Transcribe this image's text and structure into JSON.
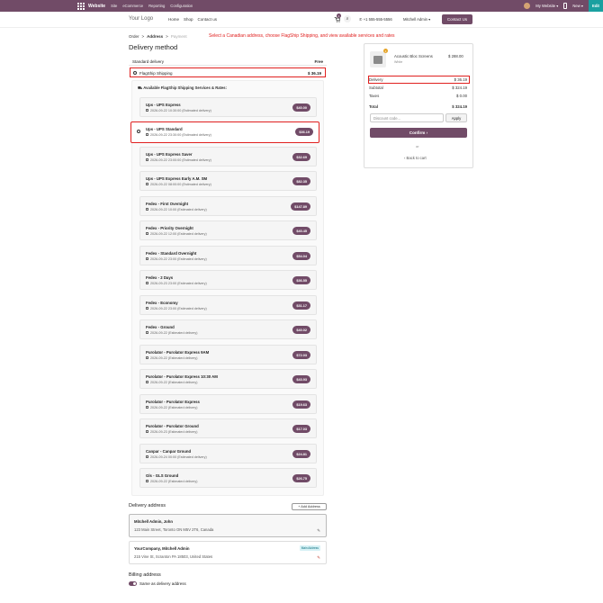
{
  "topbar": {
    "brand": "Website",
    "menu": [
      "Site",
      "eCommerce",
      "Reporting",
      "Configuration"
    ],
    "my_website": "My Website ▾",
    "new": "New ▾",
    "edit": "Edit"
  },
  "header": {
    "logo": "Your Logo",
    "nav": [
      "Home",
      "Shop",
      "Contact us"
    ],
    "cart_count": "1",
    "phone": "+1 555-555-5556",
    "user": "Mitchell Admin ▾",
    "contact_button": "Contact Us"
  },
  "breadcrumb": {
    "order": "Order",
    "address": "Address",
    "payment": "Payment",
    "sep": ">"
  },
  "hint": "Select a Canadian address, choose FlagShip Shipping, and view available services and rates",
  "delivery": {
    "title": "Delivery method",
    "standard": {
      "label": "Standard delivery",
      "value": "Free"
    },
    "flagship": {
      "label": "FlagShip Shipping",
      "value": "$ 36.19"
    },
    "rates_heading": "Available FlagShip Shipping Services & Rates:",
    "services": [
      {
        "name": "Ups - UPS Express",
        "date": "2026-09-22 10:30:00 (Estimated delivery)",
        "price": "$40.00"
      },
      {
        "name": "Ups - UPS Standard",
        "date": "2026-09-22 23:30:00 (Estimated delivery)",
        "price": "$36.19"
      },
      {
        "name": "Ups - UPS Express Saver",
        "date": "2026-09-22 23:00:00 (Estimated delivery)",
        "price": "$32.69"
      },
      {
        "name": "Ups - UPS Express Early A.M. SM",
        "date": "2026-09-22 08:00:00 (Estimated delivery)",
        "price": "$82.35"
      },
      {
        "name": "Fedex - First Overnight",
        "date": "2026-09-22 10:00 (Estimated delivery)",
        "price": "$147.89"
      },
      {
        "name": "Fedex - Priority Overnight",
        "date": "2026-09-22 12:00 (Estimated delivery)",
        "price": "$40.45"
      },
      {
        "name": "Fedex - Standard Overnight",
        "date": "2026-09-22 23:00 (Estimated delivery)",
        "price": "$54.04"
      },
      {
        "name": "Fedex - 2 Days",
        "date": "2026-09-23 23:00 (Estimated delivery)",
        "price": "$36.55"
      },
      {
        "name": "Fedex - Economy",
        "date": "2026-09-22 23:00 (Estimated delivery)",
        "price": "$31.17"
      },
      {
        "name": "Fedex - Ground",
        "date": "2026-09-22 (Estimated delivery)",
        "price": "$40.02"
      },
      {
        "name": "Purolator - Purolator Express 9AM",
        "date": "2026-09-22 (Estimated delivery)",
        "price": "$72.03"
      },
      {
        "name": "Purolator - Purolator Express 10:30 AM",
        "date": "2026-09-22 (Estimated delivery)",
        "price": "$43.93"
      },
      {
        "name": "Purolator - Purolator Express",
        "date": "2026-09-22 (Estimated delivery)",
        "price": "$19.63"
      },
      {
        "name": "Purolator - Purolator Ground",
        "date": "2026-09-23 (Estimated delivery)",
        "price": "$17.03"
      },
      {
        "name": "Canpar - Canpar Ground",
        "date": "2026-09-24 00:00 (Estimated delivery)",
        "price": "$24.81"
      },
      {
        "name": "Gls - GLS Ground",
        "date": "2026-09-22 (Estimated delivery)",
        "price": "$26.75"
      }
    ]
  },
  "addresses": {
    "title": "Delivery address",
    "add_button": "+ Add Address",
    "items": [
      {
        "name": "Mitchell Admin, John",
        "address": "123 Main Street, Toronto ON M5V 2T6, Canada"
      },
      {
        "name": "YourCompany, Mitchell Admin",
        "address": "215 Vine St, Scranton PA 18503, United States",
        "badge": "Main Address"
      }
    ]
  },
  "billing": {
    "title": "Billing address",
    "same_as": "Same as delivery address"
  },
  "summary": {
    "product_name": "Acoustic Bloc Screens",
    "product_sub": "White",
    "product_qty": "1",
    "product_price": "$ 288.00",
    "rows": [
      {
        "label": "Delivery",
        "value": "$ 36.19"
      },
      {
        "label": "Subtotal",
        "value": "$ 324.19"
      },
      {
        "label": "Taxes",
        "value": "$ 0.00"
      },
      {
        "label": "Total",
        "value": "$ 324.19"
      }
    ],
    "discount_placeholder": "Discount code...",
    "apply": "Apply",
    "confirm": "Confirm  ›",
    "or": "or",
    "back": "‹  Back to cart"
  },
  "colors": {
    "brand": "#714b67",
    "highlight": "#e0201f",
    "edit": "#1aa0a0"
  }
}
